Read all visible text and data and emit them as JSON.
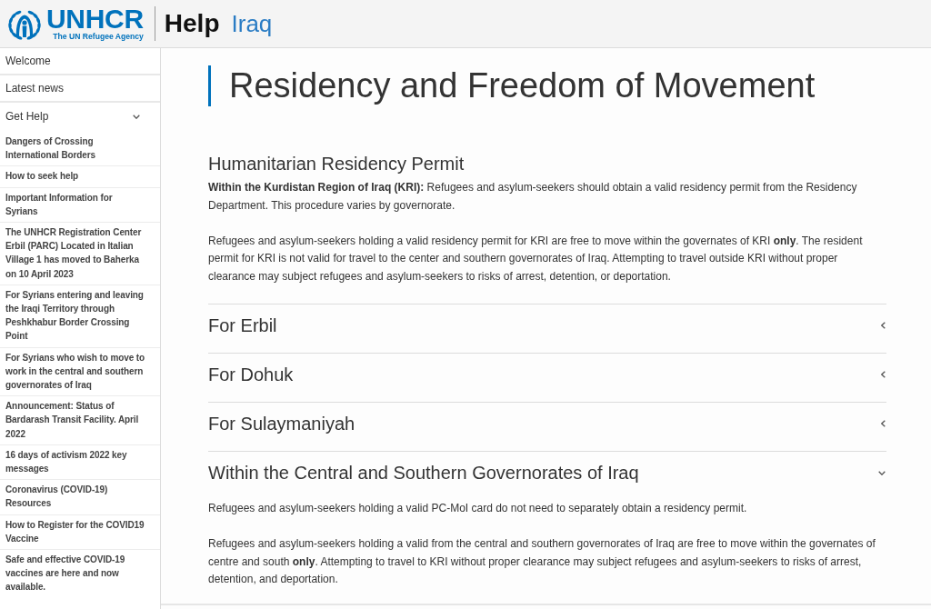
{
  "header": {
    "logo": {
      "wordmark": "UNHCR",
      "tagline": "The UN Refugee Agency"
    },
    "site_name": "Help",
    "country": "Iraq"
  },
  "sidebar": {
    "items": [
      {
        "label": "Welcome"
      },
      {
        "label": "Latest news"
      },
      {
        "label": "Get Help",
        "expanded": true,
        "children": [
          {
            "label": "Dangers of Crossing International Borders"
          },
          {
            "label": "How to seek help"
          },
          {
            "label": "Important Information for Syrians"
          },
          {
            "label": "The UNHCR Registration Center Erbil (PARC) Located in Italian Village 1 has moved to Baherka on 10 April 2023"
          },
          {
            "label": "For Syrians entering and leaving the Iraqi Territory through Peshkhabur Border Crossing Point"
          },
          {
            "label": "For Syrians who wish to move to work in the central and southern governorates of Iraq"
          },
          {
            "label": "Announcement: Status of Bardarash Transit Facility. April 2022"
          },
          {
            "label": "16 days of activism 2022 key messages"
          },
          {
            "label": "Coronavirus (COVID-19) Resources"
          },
          {
            "label": "How to Register for the COVID19 Vaccine"
          },
          {
            "label": "Safe and effective COVID-19 vaccines are here and now available."
          }
        ]
      }
    ]
  },
  "article": {
    "title": "Residency and Freedom of Movement",
    "section": {
      "heading": "Humanitarian Residency Permit",
      "paragraphs": [
        "**Within the Kurdistan Region of Iraq (KRI):** Refugees and asylum-seekers should obtain a valid residency permit from the Residency Department. This procedure varies by governorate.",
        "Refugees and asylum-seekers holding a valid residency permit for KRI are free to move within the governates of KRI **only**. The resident permit for KRI is not valid for travel to the center and southern governorates of Iraq. Attempting to travel outside KRI without proper clearance may subject refugees and asylum-seekers to risks of arrest, detention, or deportation."
      ]
    },
    "accordion": [
      {
        "title": "For Erbil",
        "expanded": false
      },
      {
        "title": "For Dohuk",
        "expanded": false
      },
      {
        "title": "For Sulaymaniyah",
        "expanded": false
      },
      {
        "title": "Within the Central and Southern Governorates of Iraq",
        "expanded": true,
        "paragraphs": [
          "Refugees and asylum-seekers holding a valid PC-MoI card do not need to separately obtain a residency permit.",
          "Refugees and asylum-seekers holding a valid from the central and southern governorates of Iraq are free to move within the governates of centre and south **only**. Attempting to travel to KRI without proper clearance may subject refugees and asylum-seekers to risks of arrest, detention, and deportation."
        ]
      }
    ]
  }
}
